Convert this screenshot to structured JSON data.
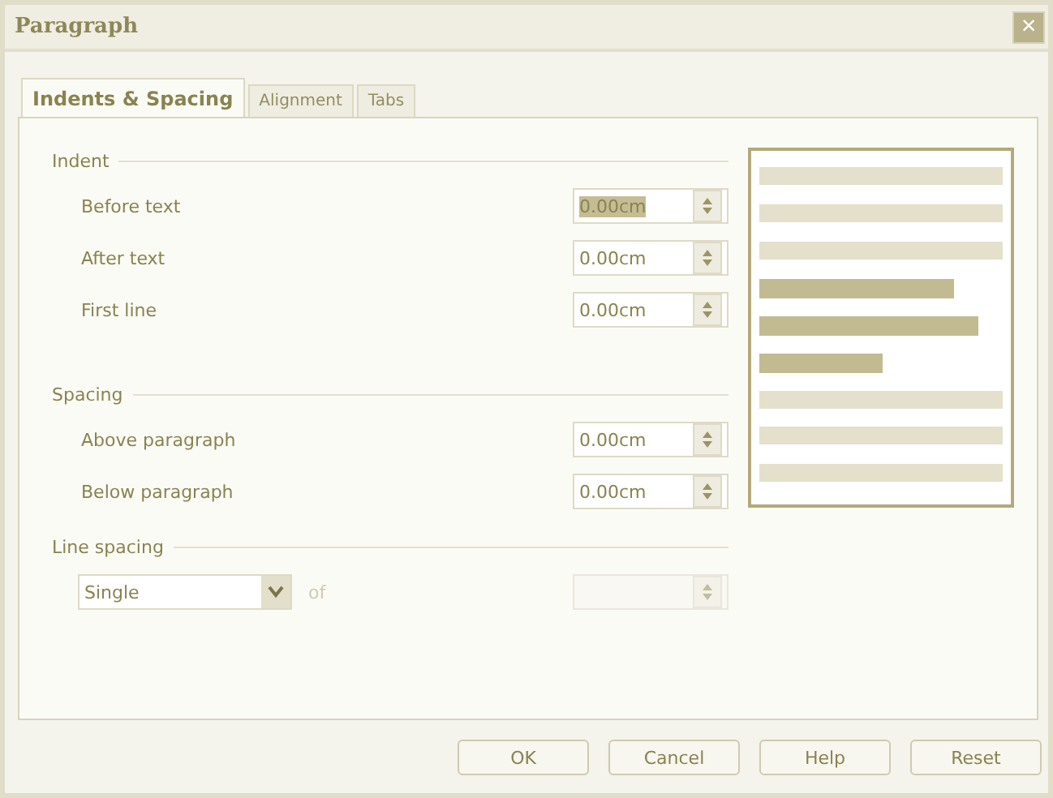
{
  "window": {
    "title": "Paragraph",
    "close": "×"
  },
  "tabs": [
    {
      "label": "Indents & Spacing",
      "selected": true
    },
    {
      "label": "Alignment",
      "selected": false
    },
    {
      "label": "Tabs",
      "selected": false
    }
  ],
  "sections": [
    {
      "heading": "Indent",
      "fields": [
        {
          "label": "Before text",
          "value": "0.00cm",
          "selected": true
        },
        {
          "label": "After text",
          "value": "0.00cm",
          "selected": false
        },
        {
          "label": "First line",
          "value": "0.00cm",
          "selected": false
        }
      ]
    },
    {
      "heading": "Spacing",
      "fields": [
        {
          "label": "Above paragraph",
          "value": "0.00cm",
          "selected": false
        },
        {
          "label": "Below paragraph",
          "value": "0.00cm",
          "selected": false
        }
      ]
    }
  ],
  "line_spacing": {
    "heading": "Line spacing",
    "dropdown": "Single",
    "of_label": "of",
    "value_disabled": true
  },
  "buttons": [
    "OK",
    "Cancel",
    "Help",
    "Reset"
  ]
}
